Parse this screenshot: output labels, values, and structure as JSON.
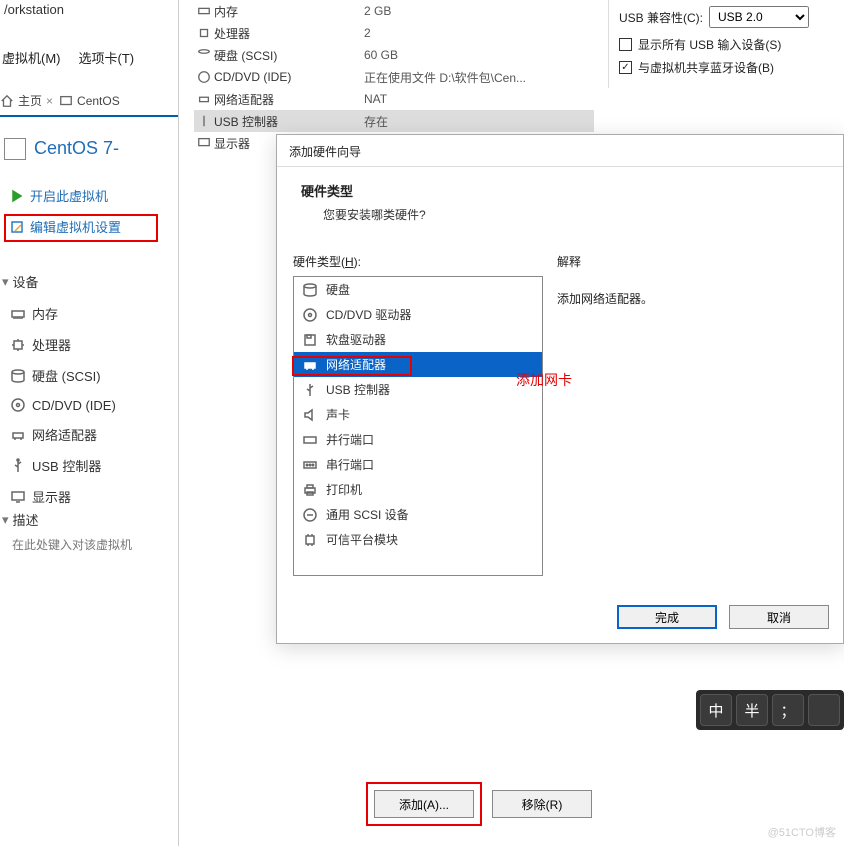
{
  "workstation": {
    "title": "/orkstation"
  },
  "menubar": {
    "vm": "虚拟机(M)",
    "tabs": "选项卡(T)"
  },
  "tabs": {
    "home": "主页",
    "vm": "CentOS"
  },
  "vm": {
    "title": "CentOS 7-"
  },
  "vm_actions": {
    "power_on": "开启此虚拟机",
    "edit": "编辑虚拟机设置"
  },
  "sections": {
    "devices": "设备",
    "description": "描述"
  },
  "devices": [
    {
      "name": "内存"
    },
    {
      "name": "处理器"
    },
    {
      "name": "硬盘 (SCSI)"
    },
    {
      "name": "CD/DVD (IDE)"
    },
    {
      "name": "网络适配器"
    },
    {
      "name": "USB 控制器"
    },
    {
      "name": "显示器"
    }
  ],
  "desc_hint": "在此处键入对该虚拟机",
  "hw_summary": [
    {
      "name": "内存",
      "value": "2 GB"
    },
    {
      "name": "处理器",
      "value": "2"
    },
    {
      "name": "硬盘 (SCSI)",
      "value": "60 GB"
    },
    {
      "name": "CD/DVD (IDE)",
      "value": "正在使用文件 D:\\软件包\\Cen..."
    },
    {
      "name": "网络适配器",
      "value": "NAT"
    },
    {
      "name": "USB 控制器",
      "value": "存在",
      "selected": true
    },
    {
      "name": "显示器",
      "value": ""
    }
  ],
  "usb": {
    "compat_label": "USB 兼容性(C):",
    "compat_value": "USB 2.0",
    "show_all": "显示所有 USB 输入设备(S)",
    "share_bt": "与虚拟机共享蓝牙设备(B)"
  },
  "wizard": {
    "title": "添加硬件向导",
    "head": "硬件类型",
    "sub": "您要安装哪类硬件?",
    "type_label": "硬件类型(",
    "type_key": "H",
    "type_label_end": "):",
    "explain_label": "解释",
    "explain_text": "添加网络适配器。",
    "options": [
      "硬盘",
      "CD/DVD 驱动器",
      "软盘驱动器",
      "网络适配器",
      "USB 控制器",
      "声卡",
      "并行端口",
      "串行端口",
      "打印机",
      "通用 SCSI 设备",
      "可信平台模块"
    ],
    "selected_index": 3,
    "finish": "完成",
    "cancel": "取消"
  },
  "annotation": {
    "add_nic": "添加网卡"
  },
  "outer_buttons": {
    "add": "添加(A)...",
    "remove": "移除(R)"
  },
  "ime": [
    "中",
    "半",
    "；",
    ""
  ],
  "watermark": "@51CTO博客"
}
